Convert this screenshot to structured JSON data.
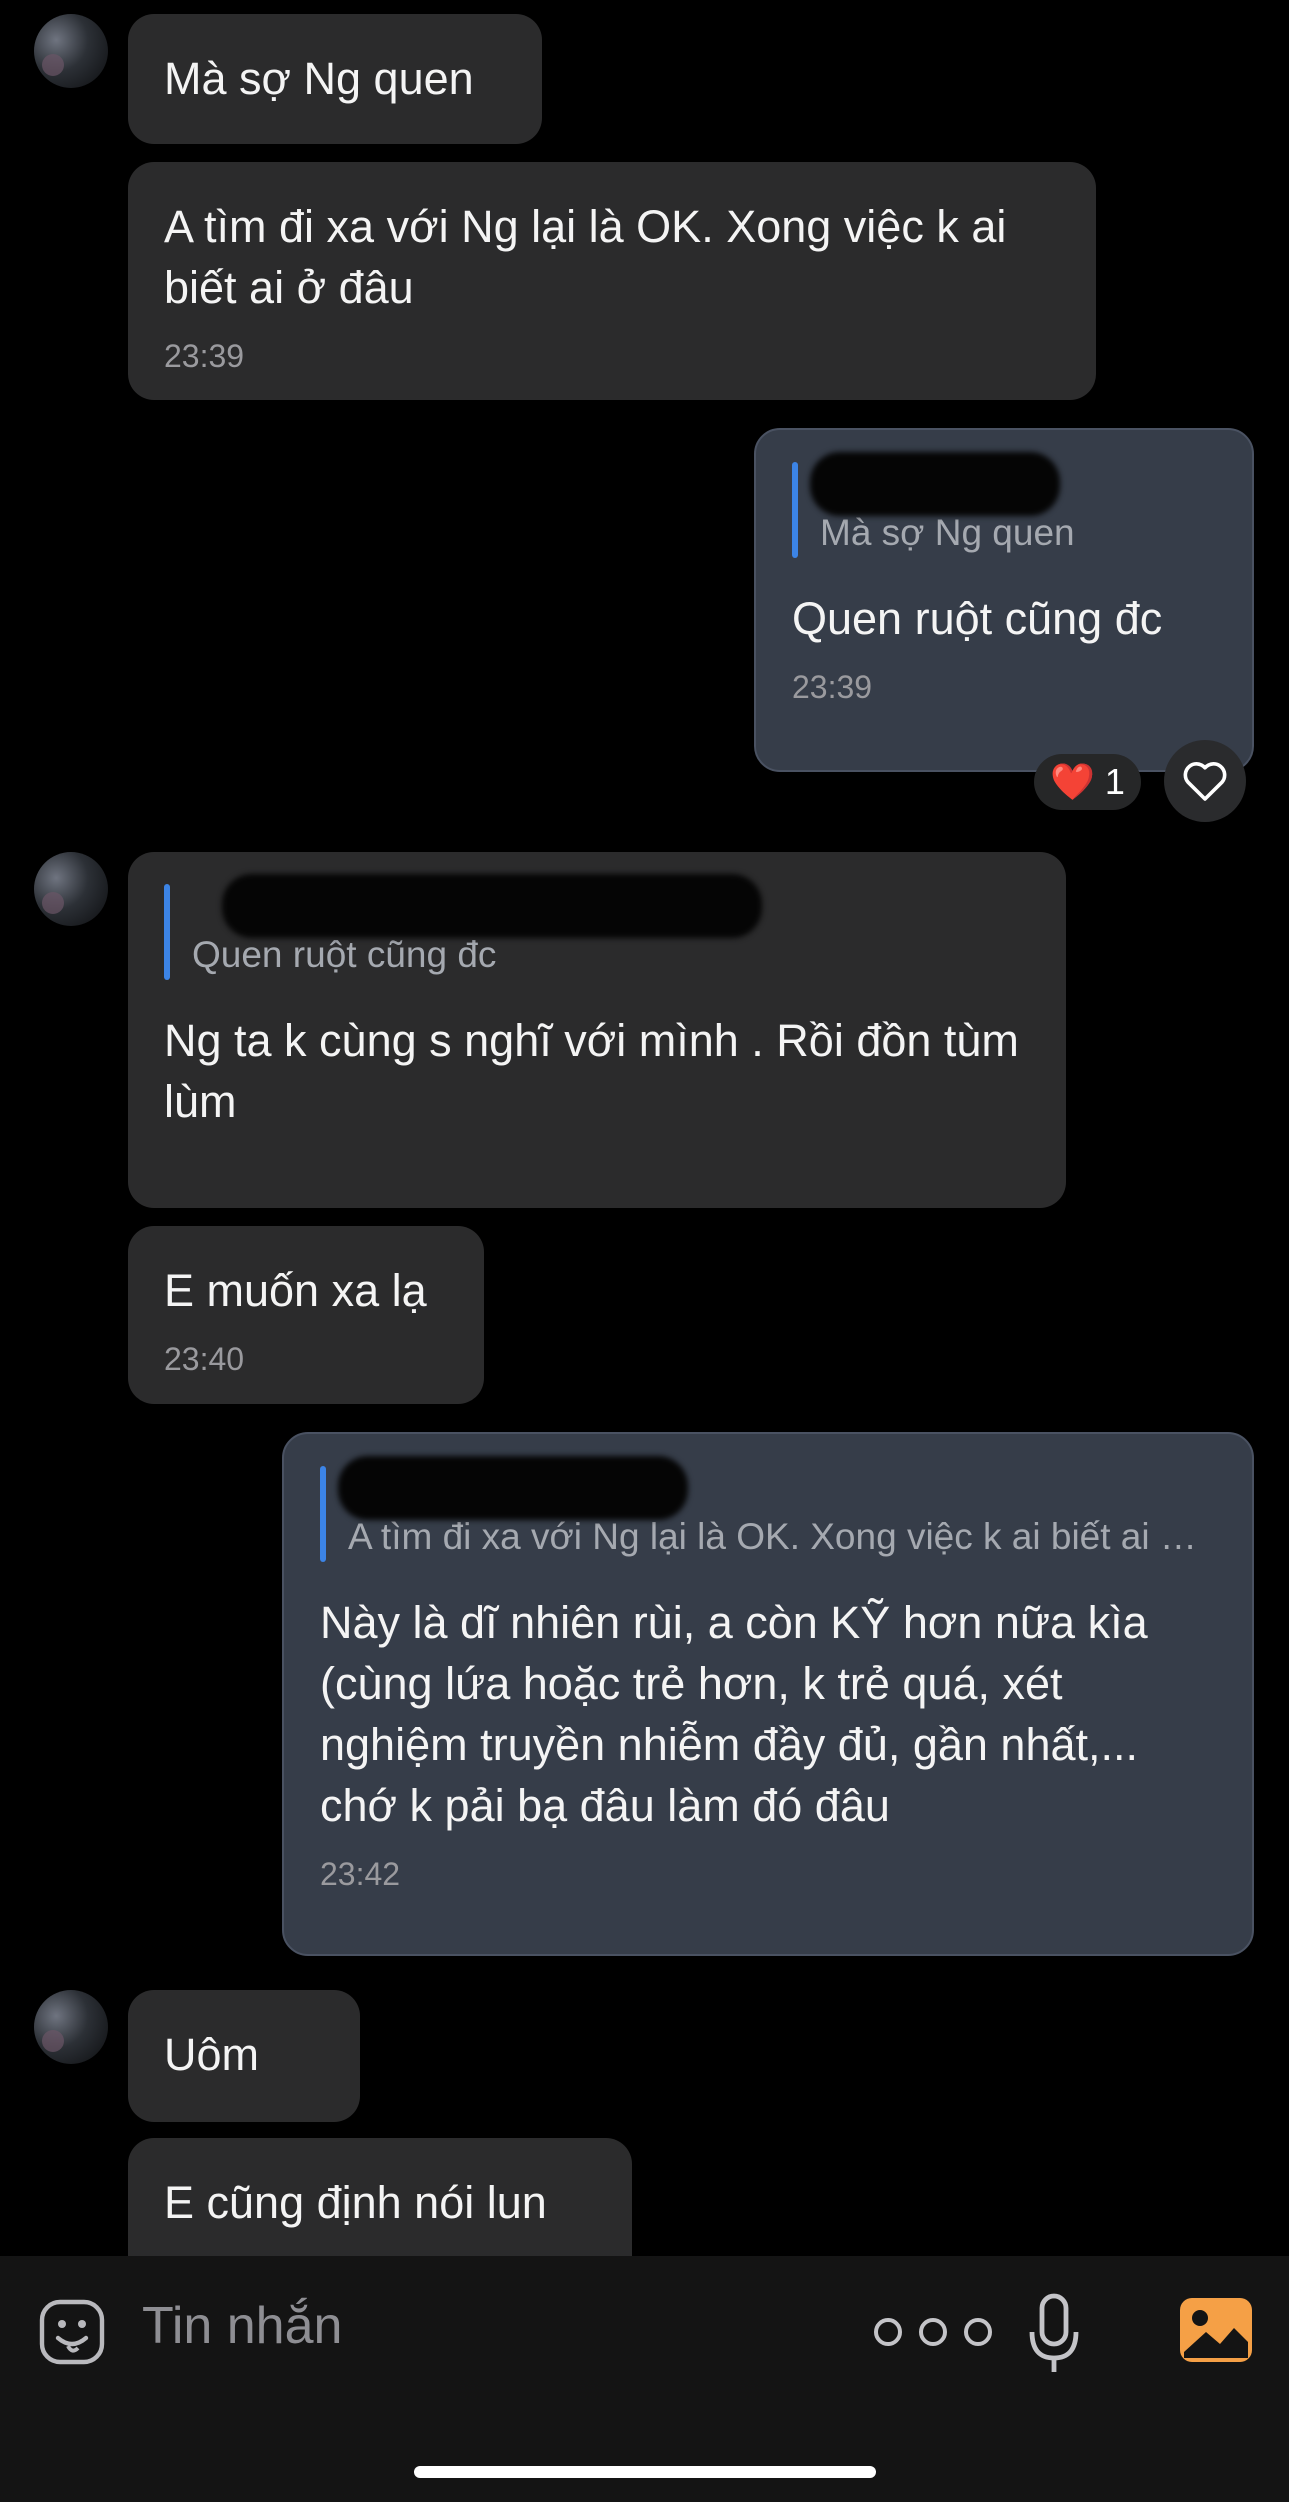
{
  "messages": [
    {
      "id": "m1",
      "text": "Mà sợ Ng quen"
    },
    {
      "id": "m2",
      "text": "A tìm đi xa với Ng lại là OK. Xong việc k ai biết ai ở đâu",
      "time": "23:39"
    },
    {
      "id": "m3",
      "quote": "Mà sợ Ng quen",
      "text": "Quen ruột cũng đc",
      "time": "23:39",
      "reaction": {
        "emoji": "❤️",
        "count": "1"
      }
    },
    {
      "id": "m4",
      "quote": "Quen ruột cũng đc",
      "text": "Ng ta k cùng s nghĩ với mình . Rồi đồn tùm lùm"
    },
    {
      "id": "m5",
      "text": "E muốn xa lạ",
      "time": "23:40"
    },
    {
      "id": "m6",
      "quote": "A tìm đi xa với Ng lại là OK. Xong việc k ai biết ai ở đâu",
      "text": "Này là dĩ nhiên rùi, a còn KỸ hơn nữa kìa (cùng lứa hoặc trẻ hơn, k trẻ quá, xét nghiệm truyền nhiễm đầy đủ, gần nhất,... chớ k pải bạ đâu làm đó đâu",
      "time": "23:42"
    },
    {
      "id": "m7",
      "text": "Uôm"
    },
    {
      "id": "m8",
      "text": "E cũng định nói lun"
    }
  ],
  "composer": {
    "placeholder": "Tin nhắn",
    "icons": [
      "sticker-icon",
      "more-icon",
      "microphone-icon",
      "image-icon"
    ]
  },
  "colors": {
    "incoming": "#2b2b2c",
    "outgoing": "#363d49",
    "quote_bar": "#3c84e6",
    "image_icon": "#f5a046"
  }
}
